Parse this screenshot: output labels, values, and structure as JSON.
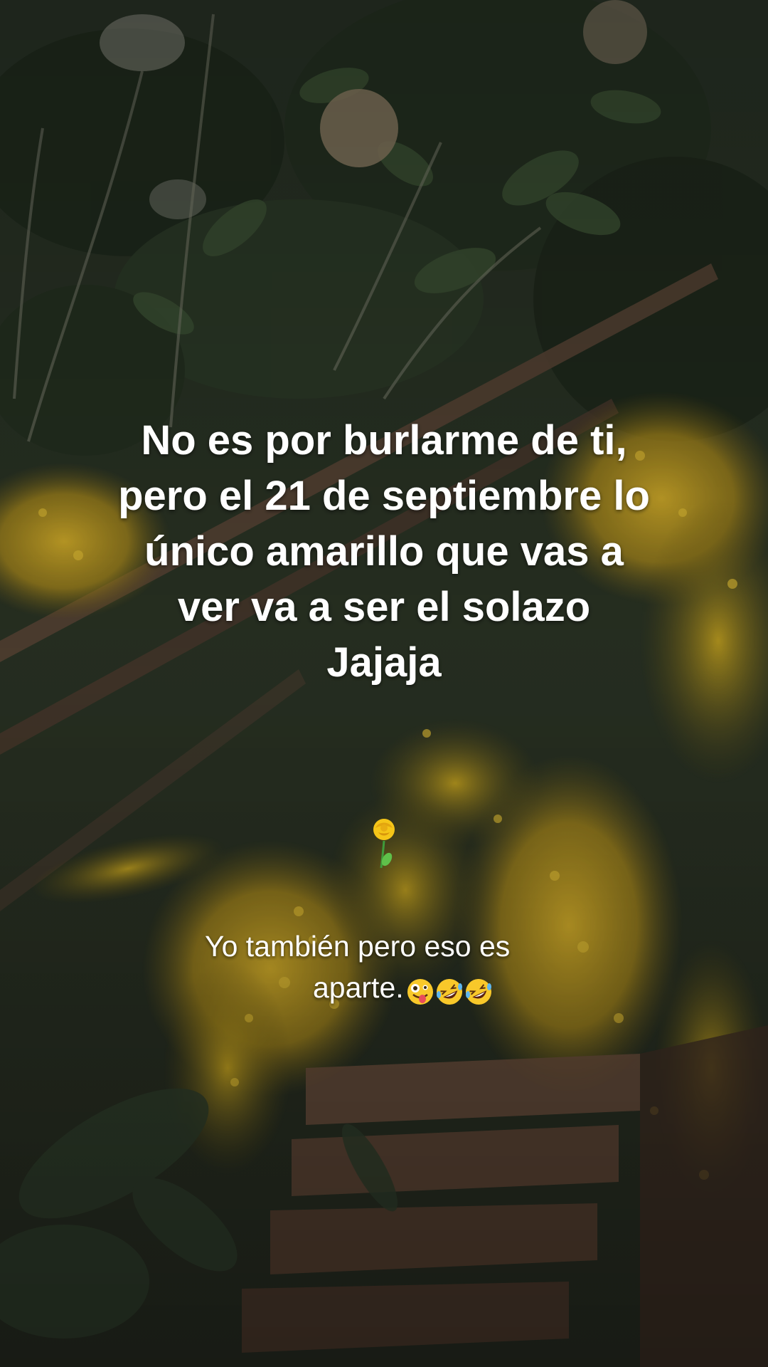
{
  "main_caption": {
    "lines": [
      "No es por burlarme de ti,",
      "pero el 21 de septiembre lo",
      "único amarillo que vas a",
      "ver va a ser el solazo",
      "Jajaja"
    ]
  },
  "reply_caption": {
    "line1": "Yo también pero eso es",
    "line2": "aparte.",
    "emojis": [
      "zany-face-emoji",
      "rolling-laughing-emoji",
      "rolling-laughing-emoji"
    ]
  },
  "decoration": {
    "flower_icon": "yellow-rose-emoji"
  },
  "colors": {
    "text": "#ffffff",
    "foliage_dark": "#1e2a1c",
    "goldenrod": "#c9a620",
    "stairs_wood": "#5a4031"
  }
}
